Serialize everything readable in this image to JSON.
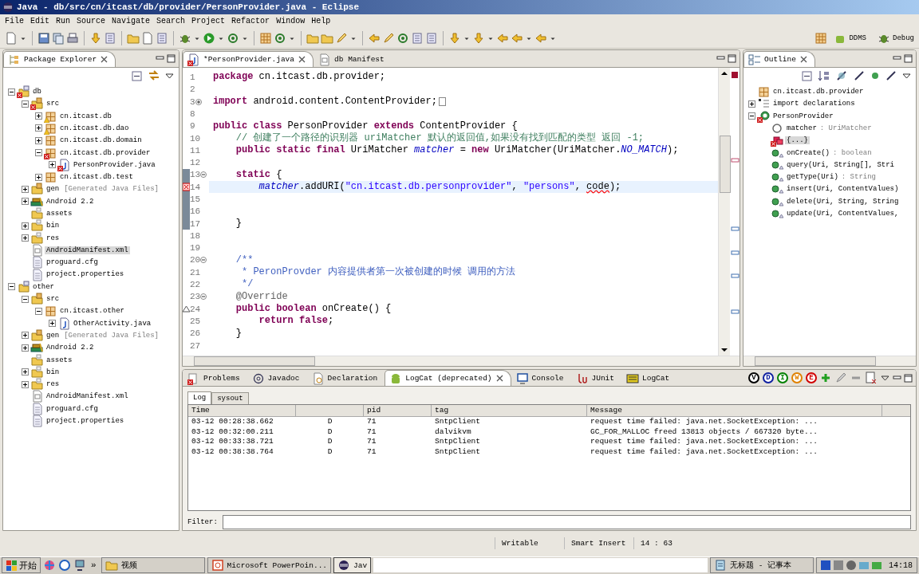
{
  "window": {
    "title": "Java - db/src/cn/itcast/db/provider/PersonProvider.java - Eclipse"
  },
  "menu": [
    "File",
    "Edit",
    "Run",
    "Source",
    "Navigate",
    "Search",
    "Project",
    "Refactor",
    "Window",
    "Help"
  ],
  "perspectives": [
    {
      "label": "DDMS",
      "selected": false
    },
    {
      "label": "Debug",
      "selected": false
    }
  ],
  "package_explorer": {
    "title": "Package Explorer",
    "tree": [
      {
        "label": "db",
        "kind": "project",
        "error": true,
        "warning": false,
        "expanded": true,
        "selected": false,
        "children": [
          {
            "label": "src",
            "kind": "source-folder",
            "error": true,
            "warning": false,
            "expanded": true,
            "selected": false,
            "children": [
              {
                "label": "cn.itcast.db",
                "kind": "package",
                "error": false,
                "warning": true,
                "expanded": false,
                "selected": false
              },
              {
                "label": "cn.itcast.db.dao",
                "kind": "package",
                "error": false,
                "warning": true,
                "expanded": false,
                "selected": false
              },
              {
                "label": "cn.itcast.db.domain",
                "kind": "package",
                "error": false,
                "warning": false,
                "expanded": false,
                "selected": false
              },
              {
                "label": "cn.itcast.db.provider",
                "kind": "package",
                "error": true,
                "warning": false,
                "expanded": true,
                "selected": false,
                "children": [
                  {
                    "label": "PersonProvider.java",
                    "kind": "java-file",
                    "error": true,
                    "warning": false,
                    "expanded": false,
                    "selected": false
                  }
                ]
              },
              {
                "label": "cn.itcast.db.test",
                "kind": "package",
                "error": false,
                "warning": false,
                "expanded": false,
                "selected": false
              }
            ]
          },
          {
            "label": "gen",
            "suffix": "[Generated Java Files]",
            "kind": "source-folder",
            "error": false,
            "warning": false,
            "expanded": false,
            "selected": false
          },
          {
            "label": "Android 2.2",
            "kind": "library",
            "error": false,
            "warning": false,
            "expanded": false,
            "selected": false
          },
          {
            "label": "assets",
            "kind": "folder",
            "error": false,
            "warning": false,
            "selected": false
          },
          {
            "label": "bin",
            "kind": "folder",
            "error": false,
            "warning": false,
            "expanded": false,
            "selected": false
          },
          {
            "label": "res",
            "kind": "folder",
            "error": false,
            "warning": false,
            "expanded": false,
            "selected": false
          },
          {
            "label": "AndroidManifest.xml",
            "kind": "xml-file",
            "error": false,
            "warning": false,
            "selected": true
          },
          {
            "label": "proguard.cfg",
            "kind": "text-file",
            "error": false,
            "warning": false,
            "selected": false
          },
          {
            "label": "project.properties",
            "kind": "text-file",
            "error": false,
            "warning": false,
            "selected": false
          }
        ]
      },
      {
        "label": "other",
        "kind": "project",
        "error": false,
        "warning": false,
        "expanded": true,
        "selected": false,
        "children": [
          {
            "label": "src",
            "kind": "source-folder",
            "error": false,
            "warning": false,
            "expanded": true,
            "selected": false,
            "children": [
              {
                "label": "cn.itcast.other",
                "kind": "package",
                "error": false,
                "warning": false,
                "expanded": true,
                "selected": false,
                "children": [
                  {
                    "label": "OtherActivity.java",
                    "kind": "java-file",
                    "error": false,
                    "warning": false,
                    "expanded": false,
                    "selected": false
                  }
                ]
              }
            ]
          },
          {
            "label": "gen",
            "suffix": "[Generated Java Files]",
            "kind": "source-folder",
            "error": false,
            "warning": false,
            "expanded": false,
            "selected": false
          },
          {
            "label": "Android 2.2",
            "kind": "library",
            "error": false,
            "warning": false,
            "expanded": false,
            "selected": false
          },
          {
            "label": "assets",
            "kind": "folder",
            "error": false,
            "warning": false,
            "selected": false
          },
          {
            "label": "bin",
            "kind": "folder",
            "error": false,
            "warning": false,
            "expanded": false,
            "selected": false
          },
          {
            "label": "res",
            "kind": "folder",
            "error": false,
            "warning": false,
            "expanded": false,
            "selected": false
          },
          {
            "label": "AndroidManifest.xml",
            "kind": "xml-file",
            "error": false,
            "warning": false,
            "selected": false
          },
          {
            "label": "proguard.cfg",
            "kind": "text-file",
            "error": false,
            "warning": false,
            "selected": false
          },
          {
            "label": "project.properties",
            "kind": "text-file",
            "error": false,
            "warning": false,
            "selected": false
          }
        ]
      }
    ]
  },
  "editor": {
    "tabs": [
      {
        "label": "*PersonProvider.java",
        "kind": "java",
        "selected": true
      },
      {
        "label": "db Manifest",
        "kind": "manifest",
        "selected": false
      }
    ],
    "lines": [
      {
        "number": "1",
        "segments": [
          {
            "text": "package",
            "kind": "keyword"
          },
          {
            "text": " cn.itcast.db.provider;",
            "kind": "plain"
          }
        ]
      },
      {
        "number": "2"
      },
      {
        "number": "3",
        "folded": true,
        "segments": [
          {
            "text": "import",
            "kind": "keyword"
          },
          {
            "text": " android.content.ContentProvider;",
            "kind": "plain"
          }
        ]
      },
      {
        "number": "8"
      },
      {
        "number": "9",
        "segments": [
          {
            "text": "public class",
            "kind": "keyword"
          },
          {
            "text": " PersonProvider ",
            "kind": "plain"
          },
          {
            "text": "extends",
            "kind": "keyword"
          },
          {
            "text": " ContentProvider {",
            "kind": "plain"
          }
        ]
      },
      {
        "number": "10",
        "segments": [
          {
            "text": "    // 创建了一个路径的识别器 uriMatcher 默认的返回值,如果没有找到匹配的类型 返回 -1;",
            "kind": "comment"
          }
        ]
      },
      {
        "number": "11",
        "segments": [
          {
            "text": "    public static final",
            "kind": "keyword"
          },
          {
            "text": " UriMatcher ",
            "kind": "plain"
          },
          {
            "text": "matcher",
            "kind": "field"
          },
          {
            "text": " = ",
            "kind": "plain"
          },
          {
            "text": "new",
            "kind": "keyword"
          },
          {
            "text": " UriMatcher(UriMatcher.",
            "kind": "plain"
          },
          {
            "text": "NO_MATCH",
            "kind": "field"
          },
          {
            "text": ");",
            "kind": "plain"
          }
        ]
      },
      {
        "number": "12"
      },
      {
        "number": "13",
        "folded": false,
        "range": true,
        "segments": [
          {
            "text": "    static",
            "kind": "keyword"
          },
          {
            "text": " {",
            "kind": "plain"
          }
        ]
      },
      {
        "number": "14",
        "error": true,
        "current": true,
        "range": true,
        "segments": [
          {
            "text": "        matcher",
            "kind": "field"
          },
          {
            "text": ".addURI(",
            "kind": "plain"
          },
          {
            "text": "\"cn.itcast.db.personprovider\"",
            "kind": "string"
          },
          {
            "text": ", ",
            "kind": "plain"
          },
          {
            "text": "\"persons\"",
            "kind": "string"
          },
          {
            "text": ", ",
            "kind": "plain"
          },
          {
            "text": "code",
            "kind": "error"
          },
          {
            "text": ");",
            "kind": "plain"
          }
        ]
      },
      {
        "number": "15",
        "range": true
      },
      {
        "number": "16",
        "range": true
      },
      {
        "number": "17",
        "range": true,
        "segments": [
          {
            "text": "    }",
            "kind": "plain"
          }
        ]
      },
      {
        "number": "18"
      },
      {
        "number": "19"
      },
      {
        "number": "20",
        "folded": false,
        "segments": [
          {
            "text": "    /**",
            "kind": "javadoc"
          }
        ]
      },
      {
        "number": "21",
        "segments": [
          {
            "text": "     * PeronProvder 内容提供者第一次被创建的时候 调用的方法",
            "kind": "javadoc"
          }
        ]
      },
      {
        "number": "22",
        "segments": [
          {
            "text": "     */",
            "kind": "javadoc"
          }
        ]
      },
      {
        "number": "23",
        "folded": false,
        "segments": [
          {
            "text": "    @Override",
            "kind": "annotation"
          }
        ]
      },
      {
        "number": "24",
        "override": true,
        "segments": [
          {
            "text": "    public boolean",
            "kind": "keyword"
          },
          {
            "text": " onCreate() {",
            "kind": "plain"
          }
        ]
      },
      {
        "number": "25",
        "segments": [
          {
            "text": "        return false",
            "kind": "keyword"
          },
          {
            "text": ";",
            "kind": "plain"
          }
        ]
      },
      {
        "number": "26",
        "segments": [
          {
            "text": "    }",
            "kind": "plain"
          }
        ]
      },
      {
        "number": "27"
      }
    ]
  },
  "outline": {
    "title": "Outline",
    "tree": [
      {
        "label": "cn.itcast.db.provider",
        "kind": "package",
        "error": false,
        "selected": false
      },
      {
        "label": "import declarations",
        "kind": "imports",
        "error": false,
        "expanded": false,
        "selected": false
      },
      {
        "label": "PersonProvider",
        "kind": "class",
        "error": true,
        "expanded": true,
        "selected": false,
        "children": [
          {
            "label": "matcher",
            "type": ": UriMatcher",
            "kind": "field",
            "error": false,
            "selected": false
          },
          {
            "label": "{...}",
            "kind": "initializer",
            "error": true,
            "selected": true
          },
          {
            "label": "onCreate()",
            "type": ": boolean",
            "kind": "method",
            "error": false,
            "selected": false
          },
          {
            "label": "query(Uri, String[], Stri",
            "kind": "method",
            "error": false,
            "selected": false
          },
          {
            "label": "getType(Uri)",
            "type": ": String",
            "kind": "method",
            "error": false,
            "selected": false
          },
          {
            "label": "insert(Uri, ContentValues)",
            "kind": "method",
            "error": false,
            "selected": false
          },
          {
            "label": "delete(Uri, String, String",
            "kind": "method",
            "error": false,
            "selected": false
          },
          {
            "label": "update(Uri, ContentValues,",
            "kind": "method",
            "error": false,
            "selected": false
          }
        ]
      }
    ]
  },
  "bottom_panel": {
    "tabs": [
      {
        "label": "Problems",
        "kind": "problems",
        "selected": false
      },
      {
        "label": "Javadoc",
        "kind": "javadoc",
        "selected": false
      },
      {
        "label": "Declaration",
        "kind": "declaration",
        "selected": false
      },
      {
        "label": "LogCat (deprecated)",
        "kind": "android",
        "selected": true
      },
      {
        "label": "Console",
        "kind": "console",
        "selected": false
      },
      {
        "label": "JUnit",
        "kind": "junit",
        "selected": false
      },
      {
        "label": "LogCat",
        "kind": "logcat",
        "selected": false
      }
    ],
    "levels": [
      {
        "label": "V",
        "color": "#000000"
      },
      {
        "label": "D",
        "color": "#1020a0"
      },
      {
        "label": "I",
        "color": "#008000"
      },
      {
        "label": "W",
        "color": "#e08000"
      },
      {
        "label": "E",
        "color": "#d00000"
      }
    ],
    "subtabs": [
      {
        "label": "Log",
        "selected": true
      },
      {
        "label": "sysout",
        "selected": false
      }
    ],
    "table": {
      "columns": [
        "Time",
        "",
        "pid",
        "tag",
        "Message"
      ],
      "rows": [
        [
          "03-12 00:28:38.662",
          "D",
          "71",
          "SntpClient",
          "request time failed: java.net.SocketException: ..."
        ],
        [
          "03-12 00:32:00.211",
          "D",
          "71",
          "dalvikvm",
          "GC_FOR_MALLOC freed 13813 objects / 667320 byte..."
        ],
        [
          "03-12 00:33:38.721",
          "D",
          "71",
          "SntpClient",
          "request time failed: java.net.SocketException: ..."
        ],
        [
          "03-12 00:38:38.764",
          "D",
          "71",
          "SntpClient",
          "request time failed: java.net.SocketException: ..."
        ]
      ]
    },
    "filter_label": "Filter:"
  },
  "status_bar": [
    "Writable",
    "Smart Insert",
    "14 : 63"
  ],
  "taskbar": {
    "start": "开始",
    "more": "»",
    "tasks": [
      {
        "label": "视频",
        "kind": "folder",
        "selected": false
      },
      {
        "label": "Microsoft PowerPoin...",
        "kind": "powerpoint",
        "selected": false
      },
      {
        "label": "Jav",
        "kind": "eclipse",
        "selected": true
      },
      {
        "label": "无标题 - 记事本",
        "kind": "notepad",
        "selected": false
      }
    ],
    "clock": "14:18"
  }
}
